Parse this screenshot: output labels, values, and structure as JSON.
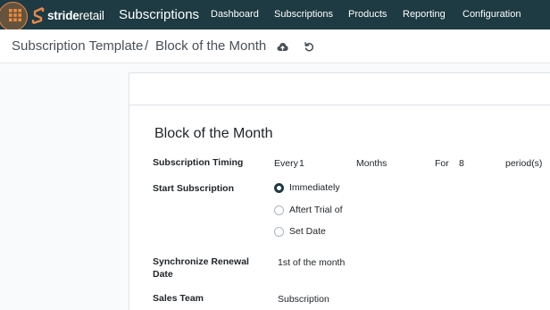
{
  "brand": {
    "part1": "stride",
    "part2": "retail"
  },
  "app_title": "Subscriptions",
  "menu": [
    {
      "label": "Dashboard"
    },
    {
      "label": "Subscriptions"
    },
    {
      "label": "Products"
    },
    {
      "label": "Reporting"
    },
    {
      "label": "Configuration"
    }
  ],
  "breadcrumb": {
    "parent": "Subscription Template",
    "separator": "/",
    "current": "Block of the Month"
  },
  "record": {
    "title": "Block of the Month",
    "timing": {
      "label": "Subscription Timing",
      "every_label": "Every",
      "every_value": "1",
      "unit": "Months",
      "for_label": "For",
      "for_value": "8",
      "period_unit": "period(s)"
    },
    "start": {
      "label": "Start Subscription",
      "options": [
        {
          "label": "Immediately",
          "checked": true
        },
        {
          "label": "Aftert Trial of",
          "checked": false
        },
        {
          "label": "Set Date",
          "checked": false
        }
      ]
    },
    "sync": {
      "label_line1": "Synchronize Renewal",
      "label_line2": "Date",
      "value": "1st of the month"
    },
    "sales_team": {
      "label": "Sales Team",
      "value": "Subscription"
    }
  },
  "icons": {
    "apps": "apps-grid-icon",
    "logo": "stride-logo-icon",
    "save": "cloud-upload-icon",
    "discard": "undo-icon",
    "radio": "radio-icon"
  },
  "colors": {
    "navbar": "#1e3a42",
    "apps_highlight": "#e9874a",
    "logo_orange": "#e9874a"
  }
}
